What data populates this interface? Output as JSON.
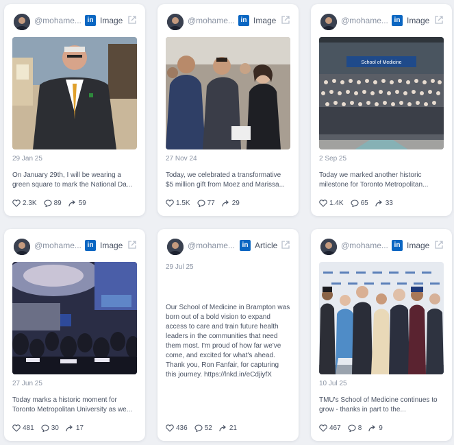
{
  "colors": {
    "linkedin": "#0a66c2",
    "muted": "#8a93a3",
    "text": "#4a5364",
    "background": "#eef0f4"
  },
  "cards": [
    {
      "handle": "@mohame...",
      "network": "in",
      "type": "Image",
      "date": "29 Jan 25",
      "text": "On January 29th, I will be wearing a green square to mark the National Da...",
      "likes": "2.3K",
      "comments": "89",
      "shares": "59"
    },
    {
      "handle": "@mohame...",
      "network": "in",
      "type": "Image",
      "date": "27 Nov 24",
      "text": "Today, we celebrated a transformative $5 million gift from Moez and Marissa...",
      "likes": "1.5K",
      "comments": "77",
      "shares": "29"
    },
    {
      "handle": "@mohame...",
      "network": "in",
      "type": "Image",
      "date": "2 Sep 25",
      "text": "Today we marked another historic milestone for Toronto Metropolitan...",
      "likes": "1.4K",
      "comments": "65",
      "shares": "33",
      "photo_sign": "School of Medicine"
    },
    {
      "handle": "@mohame...",
      "network": "in",
      "type": "Image",
      "date": "27 Jun 25",
      "text": "Today marks a historic moment for Toronto Metropolitan University as we...",
      "likes": "481",
      "comments": "30",
      "shares": "17"
    },
    {
      "handle": "@mohame...",
      "network": "in",
      "type": "Article",
      "date": "29 Jul 25",
      "text": "Our School of Medicine in Brampton was born out of a bold vision to expand access to care and train future health leaders in the communities that need them most. I'm proud of how far we've come, and excited for what's ahead. Thank you, Ron Fanfair, for capturing this journey. https://lnkd.in/eCdjiyfX",
      "likes": "436",
      "comments": "52",
      "shares": "21"
    },
    {
      "handle": "@mohame...",
      "network": "in",
      "type": "Image",
      "date": "10 Jul 25",
      "text": "TMU's School of Medicine continues to grow - thanks in part to the...",
      "likes": "467",
      "comments": "8",
      "shares": "9"
    }
  ]
}
